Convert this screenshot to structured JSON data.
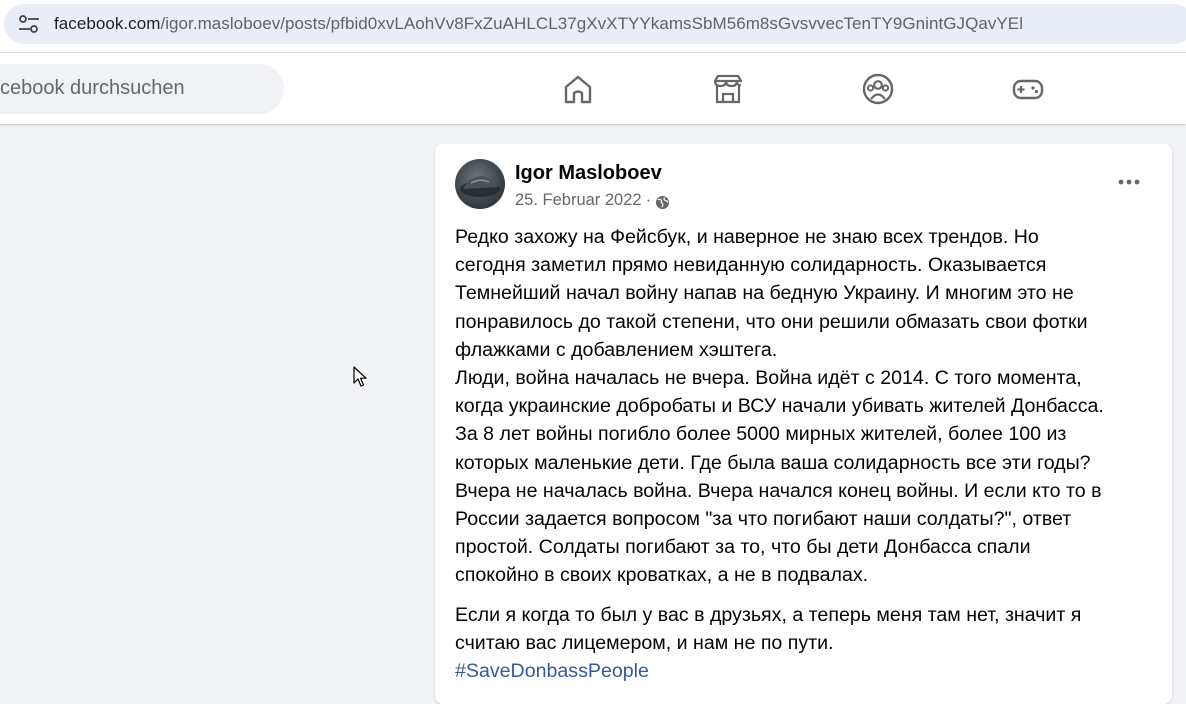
{
  "browser": {
    "url_host": "facebook.com",
    "url_path": "/igor.masloboev/posts/pfbid0xvLAohVv8FxZuAHLCL37gXvXTYYkamsSbM56m8sGvsvvecTenTY9GnintGJQavYEl"
  },
  "header": {
    "search_placeholder": "cebook durchsuchen",
    "nav": [
      "home-icon",
      "marketplace-icon",
      "groups-icon",
      "gaming-icon"
    ]
  },
  "post": {
    "author": "Igor Masloboev",
    "date": "25. Februar 2022",
    "separator": "·",
    "privacy_icon": "globe-icon",
    "lines": [
      "Редко захожу на Фейсбук, и наверное не знаю всех трендов. Но",
      "сегодня заметил прямо невиданную солидарность. Оказывается",
      "Темнейший начал войну напав на бедную Украину. И многим это не",
      "понравилось до такой степени, что они решили обмазать  свои фотки",
      "флажками с добавлением хэштега.",
      "Люди, война началась не вчера. Война идёт с 2014. С того момента,",
      "когда украинские добробаты и ВСУ начали убивать жителей Донбасса.",
      "За 8 лет войны погибло более 5000 мирных жителей, более 100 из",
      "которых маленькие дети. Где была ваша солидарность все эти годы?",
      "Вчера не началась война. Вчера начался конец войны. И если кто то  в",
      "России задается вопросом \"за что погибают наши солдаты?\", ответ",
      "простой. Солдаты погибают за то, что бы дети Донбасса спали",
      "спокойно в своих кроватках, а не в подвалах."
    ],
    "lines2": [
      "Если я когда то был у вас в друзьях, а теперь меня там нет, значит я",
      "считаю вас лицемером, и нам не по пути."
    ],
    "hashtag": "#SaveDonbassPeople"
  },
  "colors": {
    "page_bg": "#f0f2f5",
    "hashtag": "#385898",
    "secondary_text": "#65676b"
  }
}
